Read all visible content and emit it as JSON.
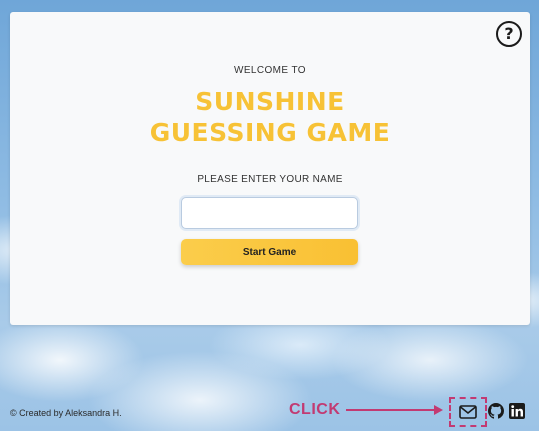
{
  "card": {
    "welcome": "WELCOME TO",
    "title_line1": "SUNSHINE",
    "title_line2": "GUESSING GAME",
    "name_label": "PLEASE ENTER YOUR NAME",
    "name_input_value": "",
    "start_button": "Start Game",
    "help_icon": "question-circle-icon",
    "help_symbol": "?"
  },
  "footer": {
    "credit": "© Created by Aleksandra H.",
    "annotation": "CLICK",
    "icons": [
      "mail-icon",
      "github-icon",
      "linkedin-icon"
    ]
  },
  "colors": {
    "title": "#f7c236",
    "button": "#f9c033",
    "annotation": "#c23a72"
  }
}
